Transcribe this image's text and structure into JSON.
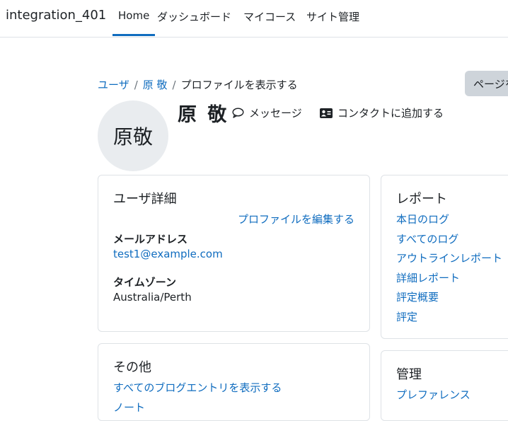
{
  "navbar": {
    "brand": "integration_401",
    "items": [
      {
        "label": "Home",
        "active": true
      },
      {
        "label": "ダッシュボード",
        "active": false
      },
      {
        "label": "マイコース",
        "active": false
      },
      {
        "label": "サイト管理",
        "active": false
      }
    ]
  },
  "breadcrumb": {
    "items": [
      "ユーザ",
      "原 敬"
    ],
    "current": "プロファイルを表示する",
    "separator": "/"
  },
  "page_button": "ページを",
  "profile": {
    "avatar_text": "原敬",
    "name": "原 敬",
    "message_label": "メッセージ",
    "contact_label": "コンタクトに追加する"
  },
  "user_details": {
    "title": "ユーザ詳細",
    "edit_link": "プロファイルを編集する",
    "email_label": "メールアドレス",
    "email_value": "test1@example.com",
    "timezone_label": "タイムゾーン",
    "timezone_value": "Australia/Perth"
  },
  "reports": {
    "title": "レポート",
    "links": [
      "本日のログ",
      "すべてのログ",
      "アウトラインレポート",
      "詳細レポート",
      "評定概要",
      "評定"
    ]
  },
  "misc": {
    "title": "その他",
    "links": [
      "すべてのブログエントリを表示する",
      "ノート"
    ]
  },
  "admin": {
    "title": "管理",
    "links": [
      "プレファレンス"
    ]
  },
  "colors": {
    "link": "#0f6cbf",
    "text": "#1d2125",
    "border": "#dee2e6",
    "avatar_bg": "#e9ecef",
    "button_bg": "#ced4da"
  }
}
